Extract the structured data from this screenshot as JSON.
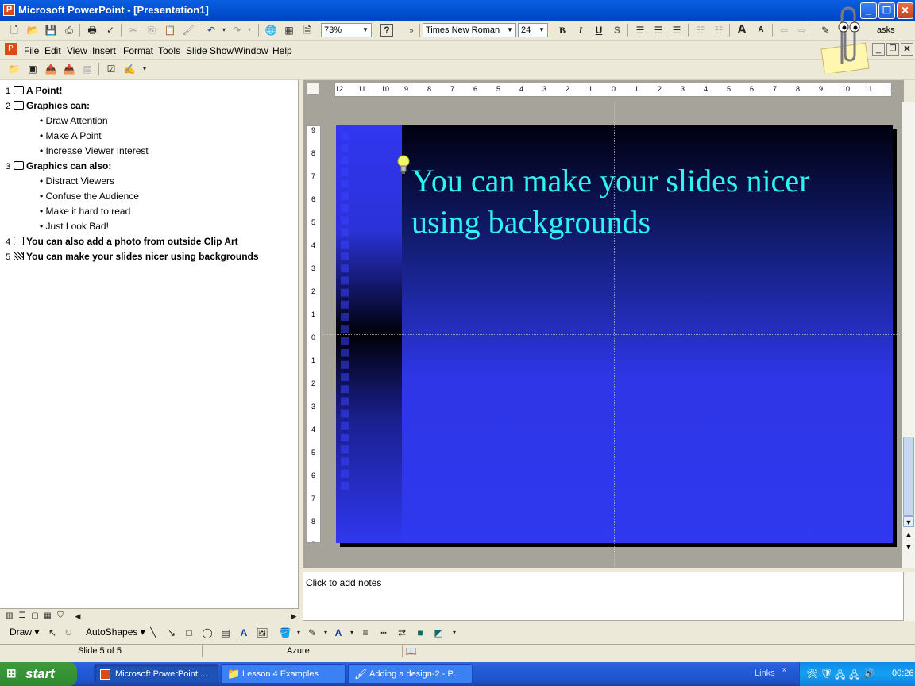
{
  "window": {
    "title": "Microsoft PowerPoint - [Presentation1]",
    "app_icon": "P"
  },
  "toolbar": {
    "zoom": "73%",
    "font": "Times New Roman",
    "font_size": "24",
    "bold": "B",
    "italic": "I",
    "underline": "U",
    "shadow": "S",
    "tasks_label": "asks"
  },
  "menu": {
    "items": [
      "File",
      "Edit",
      "View",
      "Insert",
      "Format",
      "Tools",
      "Slide Show",
      "Window",
      "Help"
    ]
  },
  "outline": {
    "slides": [
      {
        "num": "1",
        "title": "A Point!",
        "bullets": []
      },
      {
        "num": "2",
        "title": "Graphics can:",
        "bullets": [
          "Draw Attention",
          "Make A Point",
          "Increase Viewer Interest"
        ]
      },
      {
        "num": "3",
        "title": "Graphics can also:",
        "bullets": [
          "Distract Viewers",
          "Confuse the Audience",
          "Make it hard to read",
          "Just Look Bad!"
        ]
      },
      {
        "num": "4",
        "title": "You can also add a photo from outside Clip Art",
        "bullets": []
      },
      {
        "num": "5",
        "title": "You can make your slides nicer using backgrounds",
        "bullets": []
      }
    ]
  },
  "slide": {
    "title": "You can make your slides nicer using backgrounds"
  },
  "notes": {
    "placeholder": "Click to add notes"
  },
  "drawbar": {
    "draw_label": "Draw",
    "autoshapes_label": "AutoShapes"
  },
  "status": {
    "slide": "Slide 5 of 5",
    "design": "Azure"
  },
  "taskbar": {
    "start": "start",
    "tasks": [
      "Microsoft PowerPoint ...",
      "Lesson 4 Examples",
      "Adding a design-2 - P..."
    ],
    "links": "Links",
    "clock": "00:26"
  },
  "colors": {
    "title_text": "#2ef3f0",
    "slide_blue": "#3038f0",
    "xp_blue": "#0454d6"
  }
}
